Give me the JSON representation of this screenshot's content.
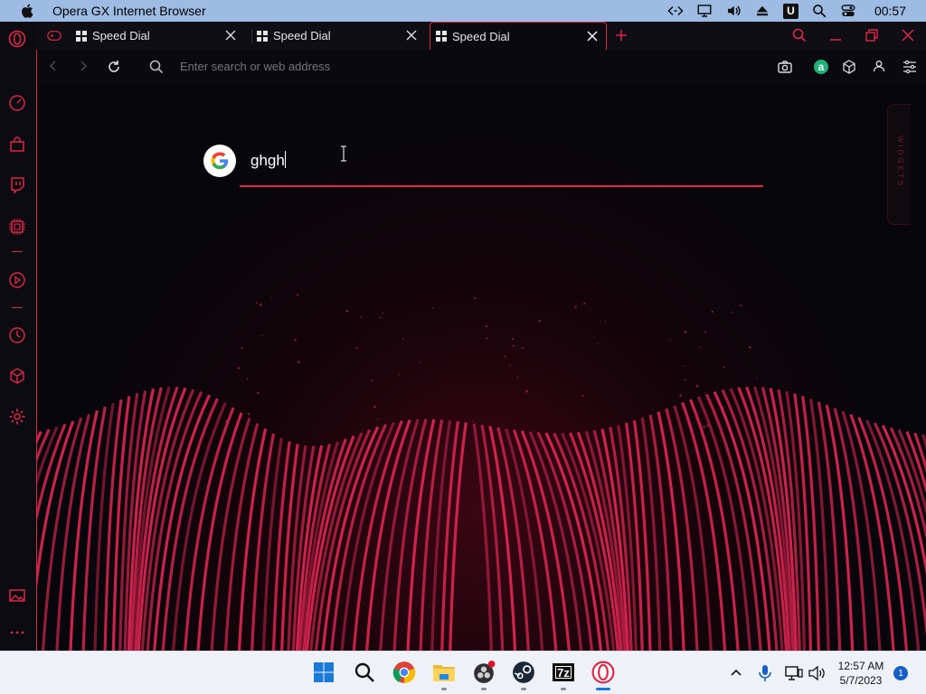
{
  "mac_menubar": {
    "app_title": "Opera GX Internet Browser",
    "clock": "00:57",
    "u_badge": "U"
  },
  "tabs": [
    {
      "label": "Speed Dial"
    },
    {
      "label": "Speed Dial"
    },
    {
      "label": "Speed Dial"
    }
  ],
  "addressbar": {
    "placeholder": "Enter search or web address",
    "aria_badge": "a"
  },
  "search": {
    "value": "ghgh"
  },
  "widgets": {
    "label": "WIDGETS"
  },
  "taskbar": {
    "time": "12:57 AM",
    "date": "5/7/2023",
    "notification_count": "1",
    "sevenzip_label": "7z"
  },
  "colors": {
    "accent": "#e0264a",
    "menubar": "#9dbbe3",
    "background": "#0a0a0e"
  }
}
